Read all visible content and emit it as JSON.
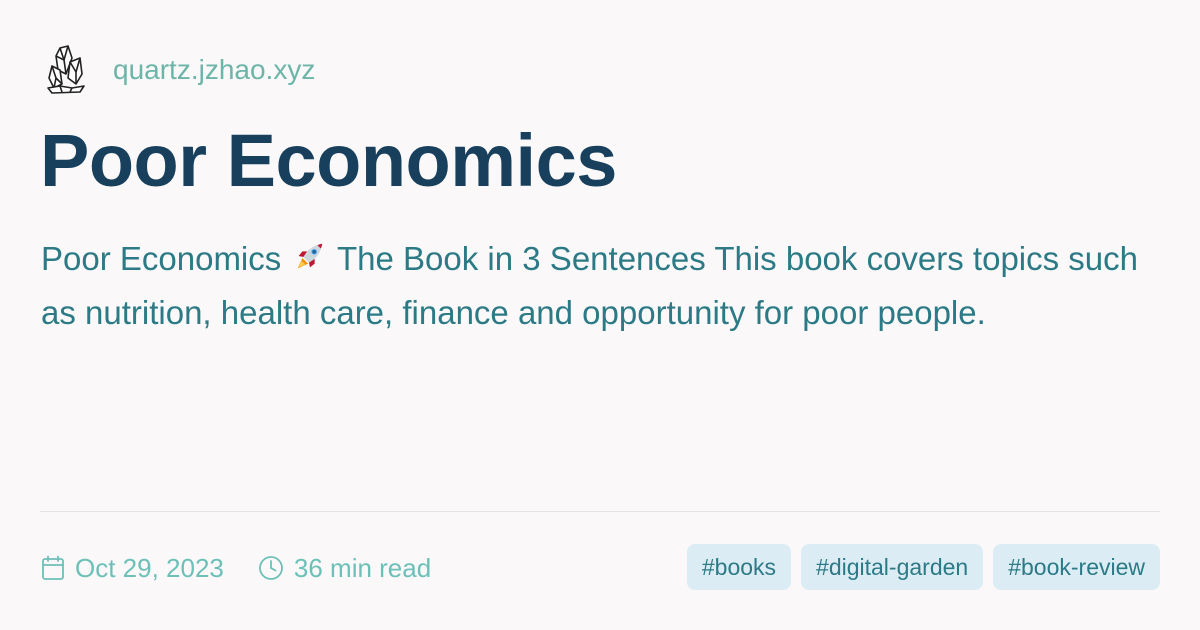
{
  "site": {
    "logo_icon": "crystal-cluster-icon",
    "url": "quartz.jzhao.xyz"
  },
  "article": {
    "title": "Poor Economics",
    "description_before_emoji": "Poor Economics",
    "description_emoji_icon": "rocket-icon",
    "description_after_emoji": "The Book in 3 Sentences This book covers topics such as nutrition, health care, finance and opportunity for poor people."
  },
  "meta": {
    "date_icon": "calendar-icon",
    "date": "Oct 29, 2023",
    "read_time_icon": "clock-icon",
    "read_time": "36 min read"
  },
  "tags": [
    "#books",
    "#digital-garden",
    "#book-review"
  ],
  "colors": {
    "background": "#faf8f8",
    "title": "#18405d",
    "description": "#2b7a85",
    "site_url": "#6cb5a8",
    "meta": "#6cc0b8",
    "tag_background": "#dcecf5",
    "tag_text": "#2b7a85"
  }
}
